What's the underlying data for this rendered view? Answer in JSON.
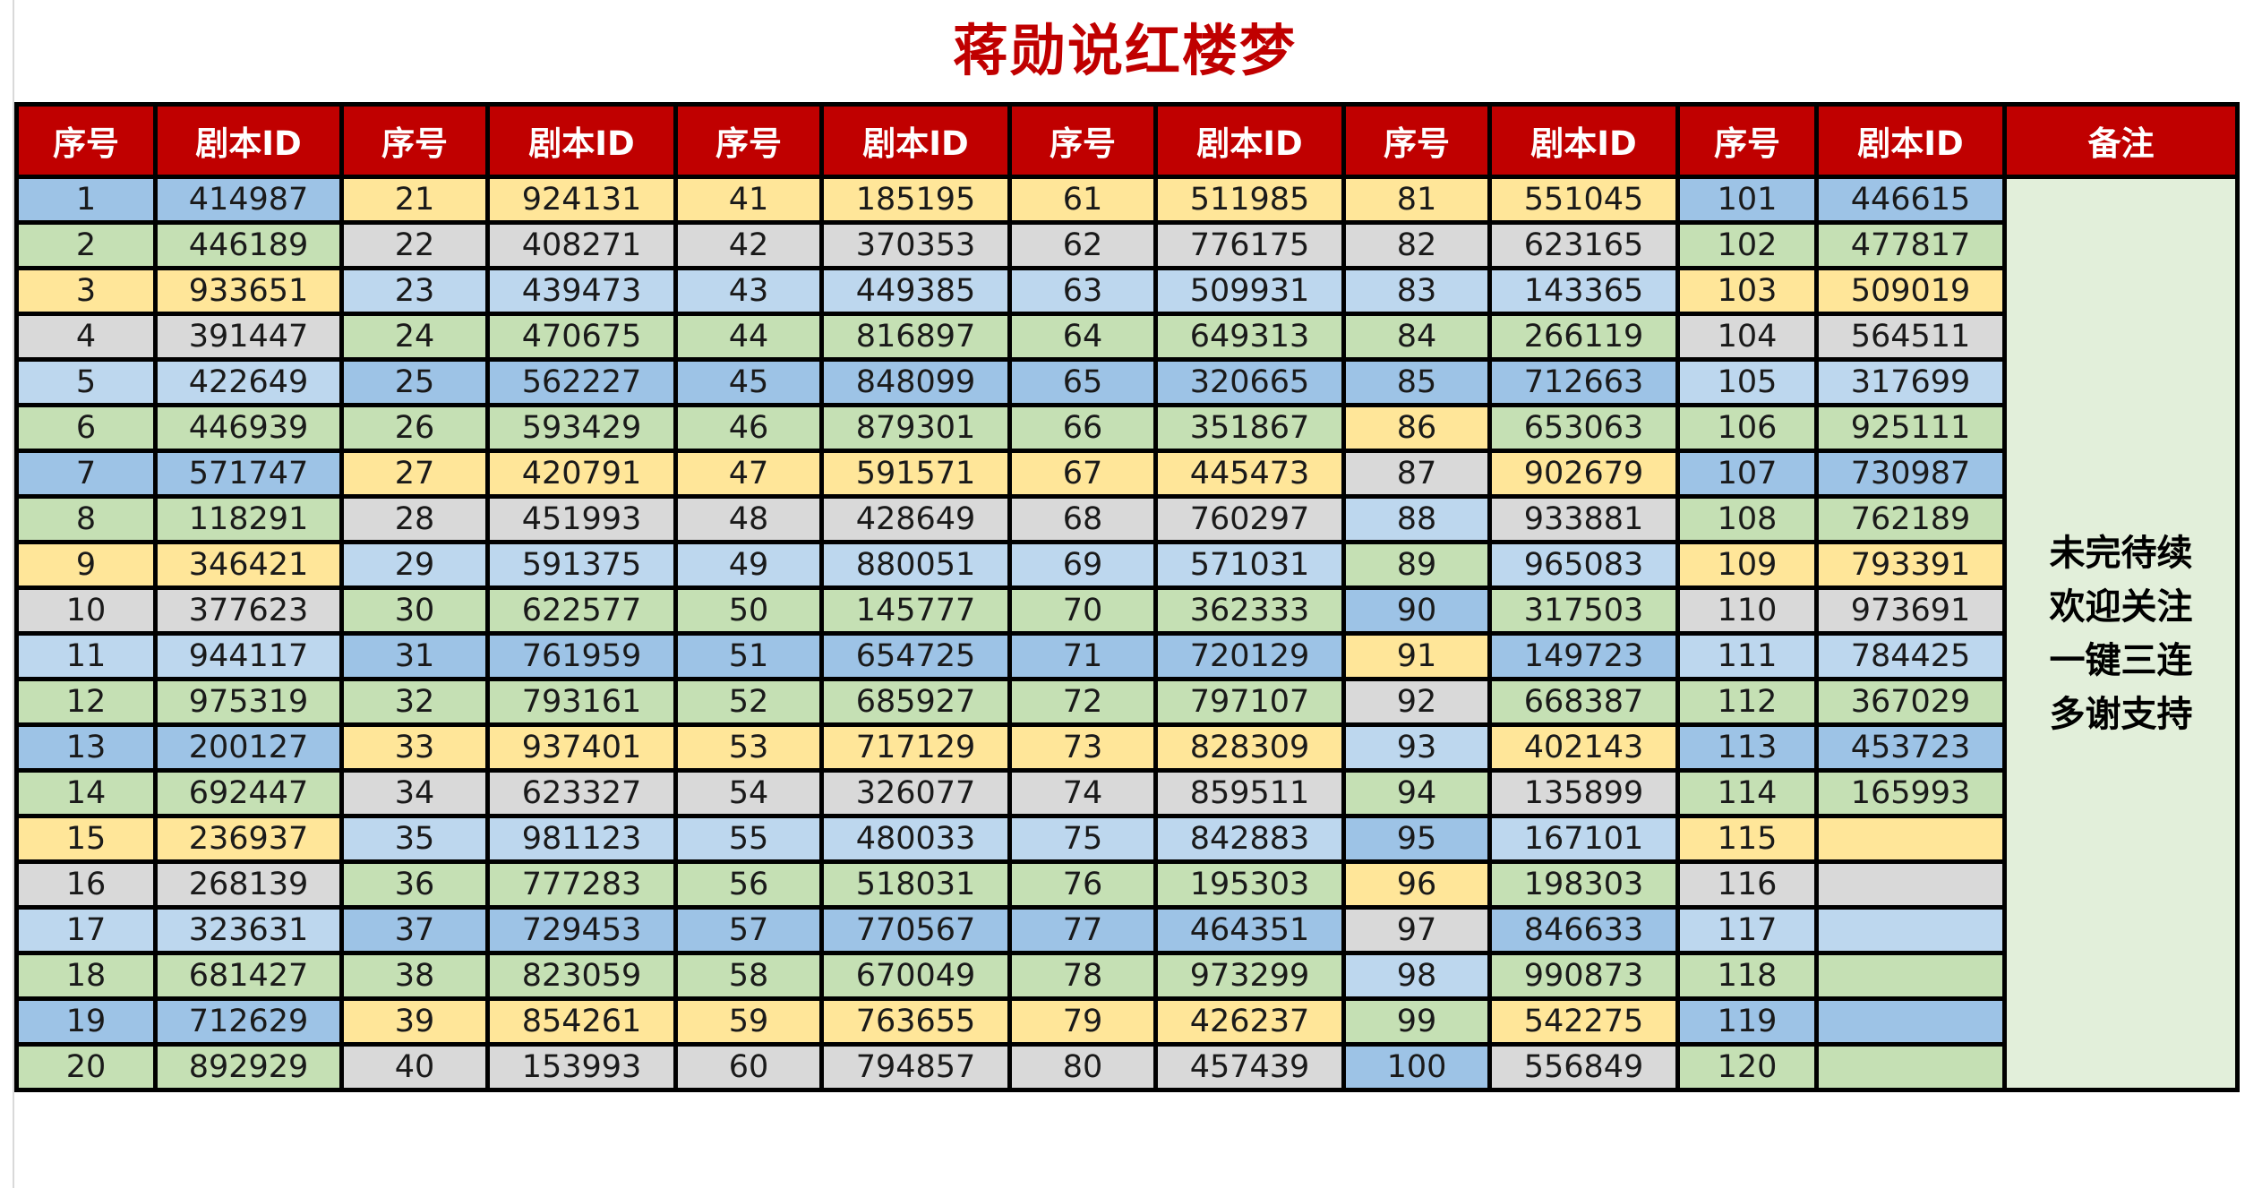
{
  "title": "蒋勋说红楼梦",
  "header": {
    "seq": "序号",
    "script_id": "剧本ID",
    "note": "备注"
  },
  "note_lines": [
    "未完待续",
    "欢迎关注",
    "一键三连",
    "多谢支持"
  ],
  "colors": {
    "header_bg": "#c00000",
    "title_text": "#c00000",
    "blue": "#9dc3e6",
    "green": "#c5e0b4",
    "yellow": "#ffe699",
    "gray": "#d9d9d9",
    "light_blue": "#bdd7ee",
    "note_bg": "#e2efda"
  },
  "groups": [
    {
      "seq": [
        "1",
        "2",
        "3",
        "4",
        "5",
        "6",
        "7",
        "8",
        "9",
        "10",
        "11",
        "12",
        "13",
        "14",
        "15",
        "16",
        "17",
        "18",
        "19",
        "20"
      ],
      "ids": [
        "414987",
        "446189",
        "933651",
        "391447",
        "422649",
        "446939",
        "571747",
        "118291",
        "346421",
        "377623",
        "944117",
        "975319",
        "200127",
        "692447",
        "236937",
        "268139",
        "323631",
        "681427",
        "712629",
        "892929"
      ],
      "colors": [
        "blue",
        "green",
        "yellow",
        "gray",
        "light_blue",
        "green",
        "blue",
        "green",
        "yellow",
        "gray",
        "light_blue",
        "green",
        "blue",
        "green",
        "yellow",
        "gray",
        "light_blue",
        "green",
        "blue",
        "green"
      ]
    },
    {
      "seq": [
        "21",
        "22",
        "23",
        "24",
        "25",
        "26",
        "27",
        "28",
        "29",
        "30",
        "31",
        "32",
        "33",
        "34",
        "35",
        "36",
        "37",
        "38",
        "39",
        "40"
      ],
      "ids": [
        "924131",
        "408271",
        "439473",
        "470675",
        "562227",
        "593429",
        "420791",
        "451993",
        "591375",
        "622577",
        "761959",
        "793161",
        "937401",
        "623327",
        "981123",
        "777283",
        "729453",
        "823059",
        "854261",
        "153993"
      ],
      "colors": [
        "yellow",
        "gray",
        "light_blue",
        "green",
        "blue",
        "green",
        "yellow",
        "gray",
        "light_blue",
        "green",
        "blue",
        "green",
        "yellow",
        "gray",
        "light_blue",
        "green",
        "blue",
        "green",
        "yellow",
        "gray"
      ]
    },
    {
      "seq": [
        "41",
        "42",
        "43",
        "44",
        "45",
        "46",
        "47",
        "48",
        "49",
        "50",
        "51",
        "52",
        "53",
        "54",
        "55",
        "56",
        "57",
        "58",
        "59",
        "60"
      ],
      "ids": [
        "185195",
        "370353",
        "449385",
        "816897",
        "848099",
        "879301",
        "591571",
        "428649",
        "880051",
        "145777",
        "654725",
        "685927",
        "717129",
        "326077",
        "480033",
        "518031",
        "770567",
        "670049",
        "763655",
        "794857"
      ],
      "colors": [
        "yellow",
        "gray",
        "light_blue",
        "green",
        "blue",
        "green",
        "yellow",
        "gray",
        "light_blue",
        "green",
        "blue",
        "green",
        "yellow",
        "gray",
        "light_blue",
        "green",
        "blue",
        "green",
        "yellow",
        "gray"
      ]
    },
    {
      "seq": [
        "61",
        "62",
        "63",
        "64",
        "65",
        "66",
        "67",
        "68",
        "69",
        "70",
        "71",
        "72",
        "73",
        "74",
        "75",
        "76",
        "77",
        "78",
        "79",
        "80"
      ],
      "ids": [
        "511985",
        "776175",
        "509931",
        "649313",
        "320665",
        "351867",
        "445473",
        "760297",
        "571031",
        "362333",
        "720129",
        "797107",
        "828309",
        "859511",
        "842883",
        "195303",
        "464351",
        "973299",
        "426237",
        "457439"
      ],
      "colors": [
        "yellow",
        "gray",
        "light_blue",
        "green",
        "blue",
        "green",
        "yellow",
        "gray",
        "light_blue",
        "green",
        "blue",
        "green",
        "yellow",
        "gray",
        "light_blue",
        "green",
        "blue",
        "green",
        "yellow",
        "gray"
      ]
    },
    {
      "seq": [
        "81",
        "82",
        "83",
        "84",
        "85",
        "86",
        "87",
        "88",
        "89",
        "90",
        "91",
        "92",
        "93",
        "94",
        "95",
        "96",
        "97",
        "98",
        "99",
        "100"
      ],
      "ids": [
        "551045",
        "623165",
        "143365",
        "266119",
        "712663",
        "653063",
        "902679",
        "933881",
        "965083",
        "317503",
        "149723",
        "668387",
        "402143",
        "135899",
        "167101",
        "198303",
        "846633",
        "990873",
        "542275",
        "556849"
      ],
      "seq_colors": [
        "yellow",
        "gray",
        "light_blue",
        "green",
        "blue",
        "yellow",
        "gray",
        "light_blue",
        "green",
        "blue",
        "yellow",
        "gray",
        "light_blue",
        "green",
        "blue",
        "yellow",
        "gray",
        "light_blue",
        "green",
        "blue"
      ],
      "colors": [
        "yellow",
        "gray",
        "light_blue",
        "green",
        "blue",
        "green",
        "yellow",
        "gray",
        "light_blue",
        "green",
        "blue",
        "green",
        "yellow",
        "gray",
        "light_blue",
        "green",
        "blue",
        "green",
        "yellow",
        "gray"
      ]
    },
    {
      "seq": [
        "101",
        "102",
        "103",
        "104",
        "105",
        "106",
        "107",
        "108",
        "109",
        "110",
        "111",
        "112",
        "113",
        "114",
        "115",
        "116",
        "117",
        "118",
        "119",
        "120"
      ],
      "ids": [
        "446615",
        "477817",
        "509019",
        "564511",
        "317699",
        "925111",
        "730987",
        "762189",
        "793391",
        "973691",
        "784425",
        "367029",
        "453723",
        "165993",
        "",
        "",
        "",
        "",
        "",
        ""
      ],
      "colors": [
        "blue",
        "green",
        "yellow",
        "gray",
        "light_blue",
        "green",
        "blue",
        "green",
        "yellow",
        "gray",
        "light_blue",
        "green",
        "blue",
        "green",
        "yellow",
        "gray",
        "light_blue",
        "green",
        "blue",
        "green"
      ]
    }
  ]
}
